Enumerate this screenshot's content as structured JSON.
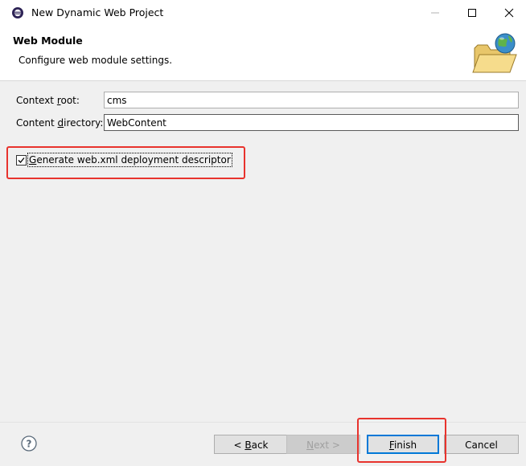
{
  "window": {
    "title": "New Dynamic Web Project",
    "controls": [
      "minimize-icon",
      "maximize-icon",
      "close-icon"
    ]
  },
  "banner": {
    "title": "Web Module",
    "description": "Configure web module settings.",
    "graphic": "folder-globe-icon"
  },
  "form": {
    "context_root": {
      "label_pre": "Context ",
      "label_mnemonic": "r",
      "label_post": "oot:",
      "value": "cms"
    },
    "content_directory": {
      "label_pre": "Content ",
      "label_mnemonic": "d",
      "label_post": "irectory:",
      "value": "WebContent"
    },
    "generate_web_xml": {
      "label_pre": "",
      "label_mnemonic": "G",
      "label_post": "enerate web.xml deployment descriptor",
      "checked": true
    }
  },
  "buttons": {
    "back": {
      "pre": "< ",
      "mnemonic": "B",
      "post": "ack",
      "enabled": true
    },
    "next": {
      "pre": "",
      "mnemonic": "N",
      "post": "ext >",
      "enabled": false
    },
    "finish": {
      "pre": "",
      "mnemonic": "F",
      "post": "inish",
      "enabled": true,
      "default": true
    },
    "cancel": {
      "label": "Cancel",
      "enabled": true
    }
  },
  "help": {
    "icon": "help-icon"
  },
  "annotations": {
    "color": "#e8332d"
  }
}
